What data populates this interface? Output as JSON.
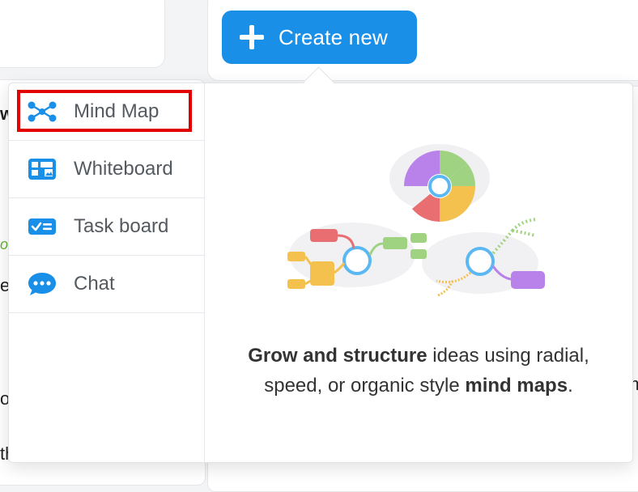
{
  "header": {
    "create_label": "Create new",
    "button_color": "#1a8fe8"
  },
  "menu": {
    "items": [
      {
        "label": "Mind Map",
        "icon": "mind-map-icon",
        "selected": true
      },
      {
        "label": "Whiteboard",
        "icon": "whiteboard-icon"
      },
      {
        "label": "Task board",
        "icon": "task-board-icon"
      },
      {
        "label": "Chat",
        "icon": "chat-icon"
      }
    ],
    "highlight_color": "#e30000",
    "icon_color": "#1a8fe8"
  },
  "preview": {
    "description_parts": [
      {
        "text": "Grow and structure",
        "bold": true
      },
      {
        "text": " ideas using radial, speed, or organic style ",
        "bold": false
      },
      {
        "text": "mind maps",
        "bold": true
      },
      {
        "text": ".",
        "bold": false
      }
    ]
  },
  "background_peeks": {
    "left_fragments": [
      "w",
      "o",
      "e",
      "o",
      "th"
    ],
    "right_fragments": [
      "m"
    ]
  }
}
